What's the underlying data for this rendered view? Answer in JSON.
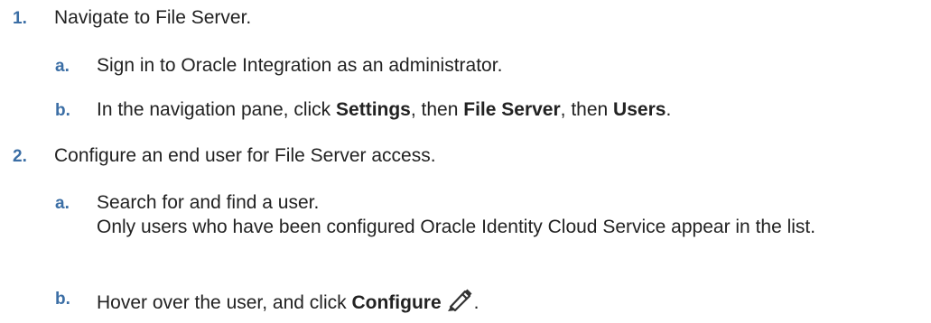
{
  "steps": [
    {
      "num": "1.",
      "text": "Navigate to File Server.",
      "substeps": [
        {
          "letter": "a.",
          "text": "Sign in to Oracle Integration as an administrator."
        },
        {
          "letter": "b.",
          "pre": "In the navigation pane, click ",
          "bold1": "Settings",
          "mid1": ", then ",
          "bold2": "File Server",
          "mid2": ", then ",
          "bold3": "Users",
          "post": "."
        }
      ]
    },
    {
      "num": "2.",
      "text": "Configure an end user for File Server access.",
      "substeps": [
        {
          "letter": "a.",
          "line1": "Search for and find a user.",
          "line2": "Only users who have been configured Oracle Identity Cloud Service appear in the list."
        },
        {
          "letter": "b.",
          "pre": "Hover over the user, and click ",
          "bold": "Configure",
          "icon": "pencil-icon",
          "post": "."
        }
      ]
    }
  ]
}
